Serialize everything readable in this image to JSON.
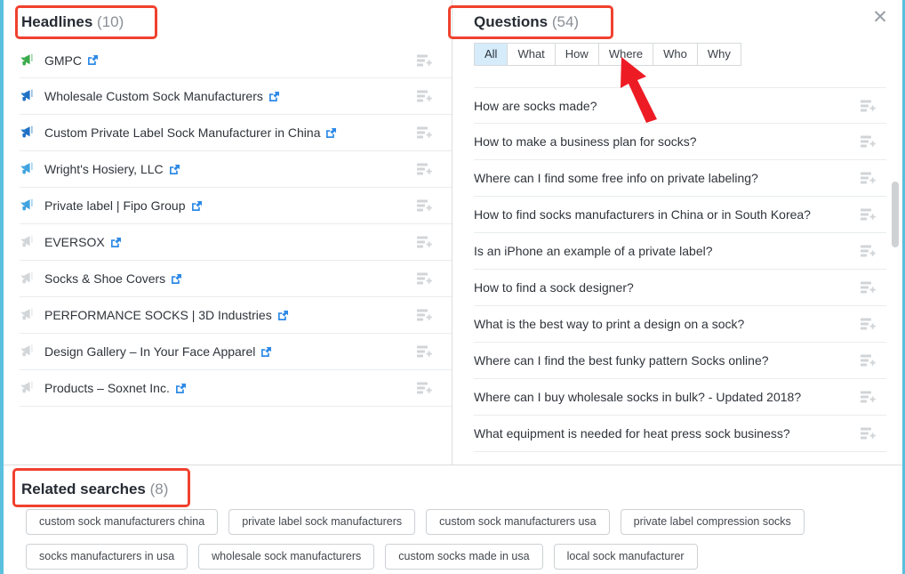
{
  "panel": {
    "close_label": "✕"
  },
  "headlines": {
    "title": "Headlines",
    "count": "(10)",
    "items": [
      {
        "text": "GMPC",
        "rank_color": "#3aab4c",
        "link_icon": "external-link-icon",
        "action_icon": "add-to-list-icon"
      },
      {
        "text": "Wholesale Custom Sock Manufacturers",
        "rank_color": "#2071c4",
        "link_icon": "external-link-icon",
        "action_icon": "add-to-list-icon"
      },
      {
        "text": "Custom Private Label Sock Manufacturer in China",
        "rank_color": "#2071c4",
        "link_icon": "external-link-icon",
        "action_icon": "add-to-list-icon"
      },
      {
        "text": "Wright's Hosiery, LLC",
        "rank_color": "#40a3e0",
        "link_icon": "external-link-icon",
        "action_icon": "add-to-list-icon"
      },
      {
        "text": "Private label | Fipo Group",
        "rank_color": "#40a3e0",
        "link_icon": "external-link-icon",
        "action_icon": "add-to-list-icon"
      },
      {
        "text": "EVERSOX",
        "rank_color": "#d3d6d9",
        "link_icon": "external-link-icon",
        "action_icon": "add-to-list-icon"
      },
      {
        "text": "Socks & Shoe Covers",
        "rank_color": "#d3d6d9",
        "link_icon": "external-link-icon",
        "action_icon": "add-to-list-icon"
      },
      {
        "text": "PERFORMANCE SOCKS | 3D Industries",
        "rank_color": "#d3d6d9",
        "link_icon": "external-link-icon",
        "action_icon": "add-to-list-icon"
      },
      {
        "text": "Design Gallery – In Your Face Apparel",
        "rank_color": "#d3d6d9",
        "link_icon": "external-link-icon",
        "action_icon": "add-to-list-icon"
      },
      {
        "text": "Products – Soxnet Inc.",
        "rank_color": "#d3d6d9",
        "link_icon": "external-link-icon",
        "action_icon": "add-to-list-icon"
      }
    ]
  },
  "questions": {
    "title": "Questions",
    "count": "(54)",
    "filters": [
      {
        "label": "All",
        "active": true
      },
      {
        "label": "What",
        "active": false
      },
      {
        "label": "How",
        "active": false
      },
      {
        "label": "Where",
        "active": false
      },
      {
        "label": "Who",
        "active": false
      },
      {
        "label": "Why",
        "active": false
      }
    ],
    "items": [
      {
        "text": "How are socks made?"
      },
      {
        "text": "How to make a business plan for socks?"
      },
      {
        "text": "Where can I find some free info on private labeling?"
      },
      {
        "text": "How to find socks manufacturers in China or in South Korea?"
      },
      {
        "text": "Is an iPhone an example of a private label?"
      },
      {
        "text": "How to find a sock designer?"
      },
      {
        "text": "What is the best way to print a design on a sock?"
      },
      {
        "text": "Where can I find the best funky pattern Socks online?"
      },
      {
        "text": "Where can I buy wholesale socks in bulk? - Updated 2018?"
      },
      {
        "text": "What equipment is needed for heat press sock business?"
      }
    ]
  },
  "related_searches": {
    "title": "Related searches",
    "count": "(8)",
    "chips": [
      "custom sock manufacturers china",
      "private label sock manufacturers",
      "custom sock manufacturers usa",
      "private label compression socks",
      "socks manufacturers in usa",
      "wholesale sock manufacturers",
      "custom socks made in usa",
      "local sock manufacturer"
    ]
  },
  "annotations": {
    "highlight_color": "#f0412e",
    "arrow_color": "#ed1c24",
    "arrow_points_to": "Where"
  }
}
